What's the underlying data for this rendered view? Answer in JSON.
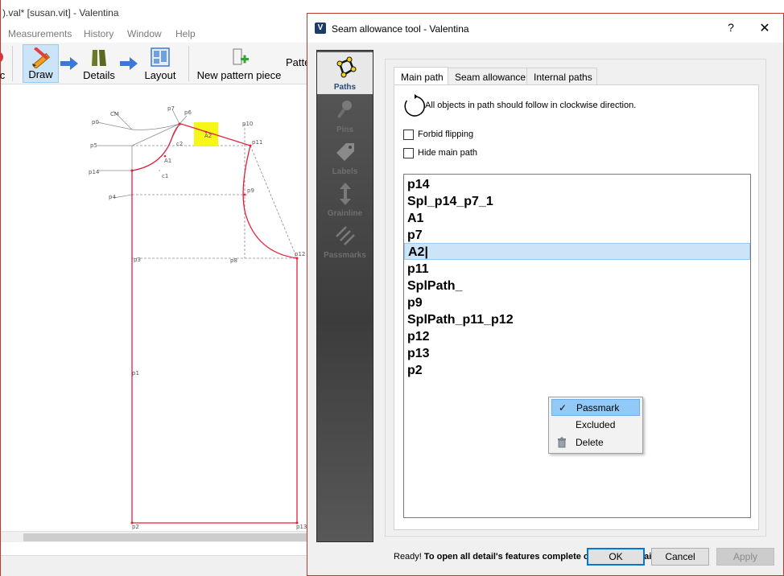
{
  "main_window": {
    "title": ").val* [susan.vit] - Valentina",
    "menu": [
      "Measurements",
      "History",
      "Window",
      "Help"
    ],
    "toolbar": {
      "left_cut_label": "c",
      "draw_label": "Draw",
      "details_label": "Details",
      "layout_label": "Layout",
      "new_pattern_piece_label": "New pattern piece",
      "pattern_label_cut": "Patte"
    },
    "drawing": {
      "point_labels": [
        "CM",
        "p0",
        "p7",
        "p6",
        "p10",
        "A2",
        "p5",
        "c2",
        "p11",
        "A1",
        "p14",
        "c1",
        "p9",
        "p4",
        "p3",
        "p8",
        "p12",
        "p1",
        "p2",
        "p13"
      ]
    },
    "colors": {
      "outline": "#e0203a",
      "guides": "#8c8c8c",
      "highlight": "#f5f500"
    }
  },
  "dialog": {
    "title": "Seam allowance tool - Valentina",
    "help_glyph": "?",
    "close_glyph": "✕",
    "nav": [
      {
        "label": "Paths",
        "icon": "paths-icon",
        "selected": true
      },
      {
        "label": "Pins",
        "icon": "pin-icon",
        "selected": false
      },
      {
        "label": "Labels",
        "icon": "label-tag-icon",
        "selected": false
      },
      {
        "label": "Grainline",
        "icon": "grainline-arrow-icon",
        "selected": false
      },
      {
        "label": "Passmarks",
        "icon": "passmarks-icon",
        "selected": false
      }
    ],
    "tabs": [
      "Main path",
      "Seam allowance",
      "Internal paths"
    ],
    "active_tab": "Main path",
    "direction_text": "All objects in path should follow in clockwise direction.",
    "forbid_flipping_label": "Forbid flipping",
    "forbid_flipping_checked": false,
    "hide_main_path_label": "Hide main path",
    "hide_main_path_checked": false,
    "path_items": [
      "p14",
      "Spl_p14_p7_1",
      "A1",
      "p7",
      "A2|",
      "p11",
      "SplPath_",
      "p9",
      "SplPath_p11_p12",
      "p12",
      "p13",
      "p2"
    ],
    "selected_item": "A2|",
    "context_menu": {
      "items": [
        {
          "label": "Passmark",
          "checked": true,
          "hover": true,
          "icon": "check-icon"
        },
        {
          "label": "Excluded",
          "checked": false,
          "hover": false,
          "icon": ""
        },
        {
          "label": "Delete",
          "checked": false,
          "hover": false,
          "icon": "trash-icon"
        }
      ]
    },
    "status_ready": "Ready!",
    "status_message": "To open all detail's features complete creating the main path.",
    "buttons": {
      "ok": "OK",
      "cancel": "Cancel",
      "apply": "Apply"
    },
    "apply_enabled": false,
    "colors": {
      "selection": "#cce4f7",
      "menu_hover": "#91c9f7",
      "default_button_border": "#0078d7"
    }
  }
}
